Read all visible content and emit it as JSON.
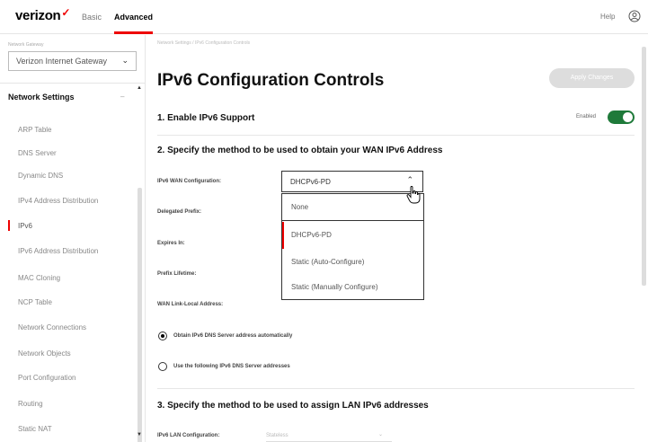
{
  "header": {
    "logo": "verizon",
    "logo_mark": "✓",
    "nav_basic": "Basic",
    "nav_advanced": "Advanced",
    "help": "Help"
  },
  "sidebar": {
    "device_label": "Network Gateway",
    "device_select": "Verizon Internet Gateway",
    "section_title": "Network Settings",
    "items": [
      {
        "label": "ARP Table"
      },
      {
        "label": "DNS Server"
      },
      {
        "label": "Dynamic DNS"
      },
      {
        "label": "IPv4 Address Distribution"
      },
      {
        "label": "IPv6"
      },
      {
        "label": "IPv6 Address Distribution"
      },
      {
        "label": "MAC Cloning"
      },
      {
        "label": "NCP Table"
      },
      {
        "label": "Network Connections"
      },
      {
        "label": "Network Objects"
      },
      {
        "label": "Port Configuration"
      },
      {
        "label": "Routing"
      },
      {
        "label": "Static NAT"
      }
    ],
    "active_index": 4
  },
  "main": {
    "breadcrumb": "Network Settings / IPv6 Configuration Controls",
    "title": "IPv6 Configuration Controls",
    "apply_button": "Apply Changes",
    "section1": "1. Enable IPv6 Support",
    "enabled_label": "Enabled",
    "section2": "2. Specify the method to be used to obtain your WAN IPv6 Address",
    "fields": {
      "wan_config": "IPv6 WAN Configuration:",
      "delegated_prefix": "Delegated Prefix:",
      "expires_in": "Expires In:",
      "prefix_lifetime": "Prefix Lifetime:",
      "wan_link_local": "WAN Link-Local Address:"
    },
    "wan_select_value": "DHCPv6-PD",
    "dropdown_options": [
      "None",
      "DHCPv6-PD",
      "Static (Auto-Configure)",
      "Static (Manually Configure)"
    ],
    "dropdown_selected_index": 1,
    "radio_obtain": "Obtain IPv6 DNS Server address automatically",
    "radio_use": "Use the following IPv6 DNS Server addresses",
    "section3": "3. Specify the method to be used to assign LAN IPv6 addresses",
    "lan_config_label": "IPv6 LAN Configuration:",
    "lan_select_value": "Stateless"
  },
  "colors": {
    "accent": "#e00000",
    "toggle_on": "#1f7a3a",
    "text_muted": "#888888"
  }
}
